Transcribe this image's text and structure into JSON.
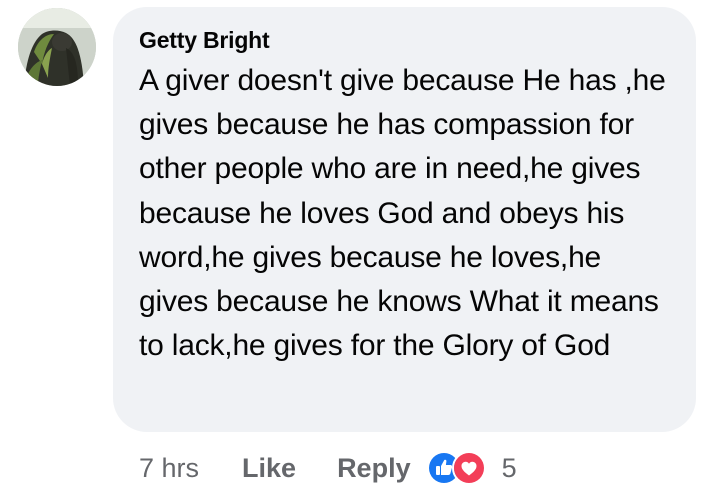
{
  "comment": {
    "author": "Getty Bright",
    "text": "A giver doesn't give because He has ,he gives because he has compassion for other people who are in need,he gives because he loves God and obeys his word,he gives because he loves,he gives because he knows What it means to lack,he gives for the Glory of God"
  },
  "actions": {
    "timestamp": "7 hrs",
    "like_label": "Like",
    "reply_label": "Reply",
    "reaction_count": "5",
    "reaction_icons": [
      "like-reaction-icon",
      "love-reaction-icon"
    ]
  },
  "colors": {
    "bubble": "#f0f2f5",
    "text": "#050505",
    "meta": "#65676b",
    "like_blue": "#1877f2",
    "love_red": "#f33e58"
  }
}
